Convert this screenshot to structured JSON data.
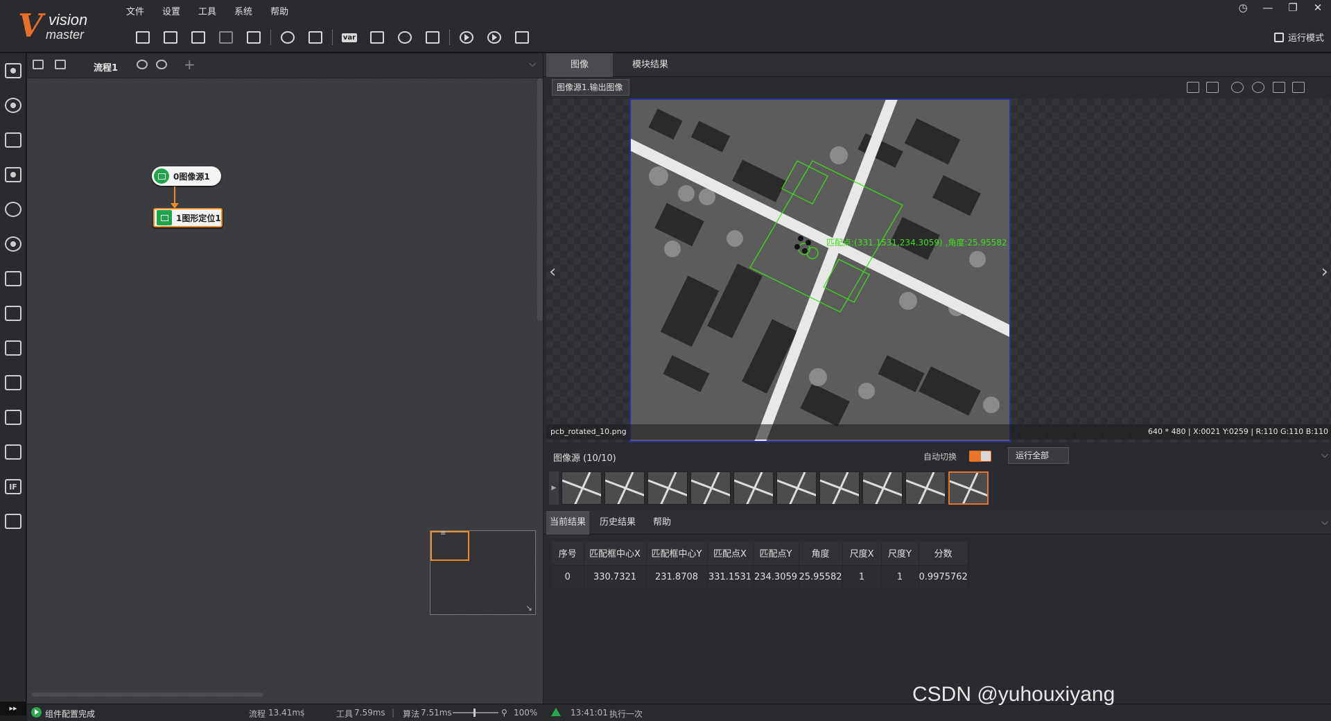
{
  "app": {
    "logo_v": "V",
    "logo_line1": "vision",
    "logo_line2": "master",
    "brand_color": "#e9702a"
  },
  "menu": [
    "文件",
    "设置",
    "工具",
    "系统",
    "帮助"
  ],
  "window_controls": [
    "clock-icon",
    "minimize-icon",
    "restore-icon",
    "close-icon"
  ],
  "toolbar": {
    "icons": [
      "save-icon",
      "open-folder-icon",
      "save-as-icon",
      "import-icon",
      "lock-icon",
      "camera-icon",
      "controller-icon",
      "var-icon",
      "device-icon",
      "communication-icon",
      "code-icon",
      "run-once-icon",
      "run-loop-icon",
      "edit-icon"
    ],
    "var_label": "var",
    "run_mode_label": "运行模式"
  },
  "left_tools": [
    "camera-icon",
    "locate-icon",
    "measure-icon",
    "recognize-icon",
    "defect-icon",
    "calibration-icon",
    "contrast-icon",
    "calculate-icon",
    "image-process-icon",
    "color-icon",
    "deep-learning-icon",
    "image-edit-icon",
    "if-icon",
    "communication-icon"
  ],
  "left_tools_if_label": "IF",
  "left_strip_bottom": "▸▸",
  "flow": {
    "tab_name": "流程1",
    "add_label": "+",
    "chevron": "⌵",
    "nodes": [
      {
        "label": "0图像源1",
        "icon": "image-source-icon"
      },
      {
        "label": "1图形定位1",
        "icon": "pattern-locate-icon"
      }
    ],
    "connector_color": "#f08a24",
    "minimap_glyph": "≡",
    "minimap_resize": "↘"
  },
  "status": {
    "message": "组件配置完成",
    "flow_label": "流程",
    "flow_time": "13.41ms",
    "tool_label": "工具",
    "tool_time": "7.59ms",
    "algo_label": "算法",
    "algo_time": "7.51ms",
    "zoom": "100%",
    "exec_time": "13:41:01",
    "exec_text": "执行一次"
  },
  "image_panel": {
    "tabs": [
      "图像",
      "模块结果"
    ],
    "source_select": "图像源1.输出图像",
    "view_buttons": [
      "layout-single-icon",
      "layout-grid-icon",
      "zoom-in-icon",
      "zoom-out-icon",
      "actual-size-icon",
      "fit-icon"
    ],
    "nav_left": "‹",
    "nav_right": "›",
    "overlay_text": "匹配点:(331.1531,234.3059) ,角度:25.95582",
    "overlay_color": "#3ee018",
    "filename": "pcb_rotated_10.png",
    "pixel_info": "640 * 480  |  X:0021  Y:0259  |  R:110  G:110  B:110"
  },
  "source_bar": {
    "label": "图像源 (10/10)",
    "auto_switch_label": "自动切换",
    "auto_switch_on": true,
    "run_all_label": "运行全部",
    "chevron": "⌵",
    "thumbnail_count": 10,
    "active_thumbnail": 10,
    "arrow": "▶"
  },
  "results": {
    "tabs": [
      "当前结果",
      "历史结果",
      "帮助"
    ],
    "chevron": "⌵",
    "columns": [
      "序号",
      "匹配框中心X",
      "匹配框中心Y",
      "匹配点X",
      "匹配点Y",
      "角度",
      "尺度X",
      "尺度Y",
      "分数"
    ],
    "rows": [
      [
        "0",
        "330.7321",
        "231.8708",
        "331.1531",
        "234.3059",
        "25.95582",
        "1",
        "1",
        "0.9975762"
      ]
    ]
  },
  "watermark": "CSDN @yuhouxiyang"
}
